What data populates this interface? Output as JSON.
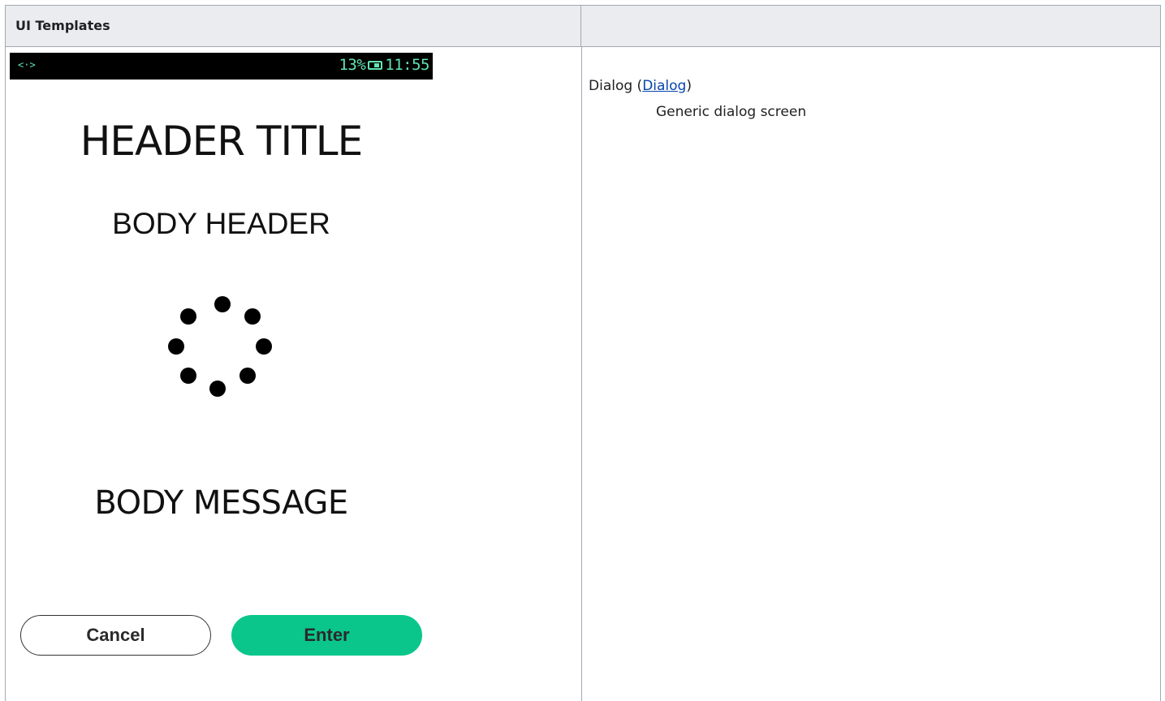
{
  "table": {
    "header_left": "UI Templates",
    "header_right": ""
  },
  "device": {
    "statusbar": {
      "left_icon": "<·>",
      "battery_percent": "13%",
      "time": "11:55",
      "color": "#62e3b3"
    },
    "header_title": "HEADER TITLE",
    "body_header": "BODY HEADER",
    "body_message": "BODY MESSAGE",
    "buttons": {
      "cancel_label": "Cancel",
      "enter_label": "Enter",
      "enter_color": "#0ac68a"
    }
  },
  "description": {
    "name": "Dialog",
    "link_text": "Dialog",
    "summary": "Generic dialog screen"
  }
}
